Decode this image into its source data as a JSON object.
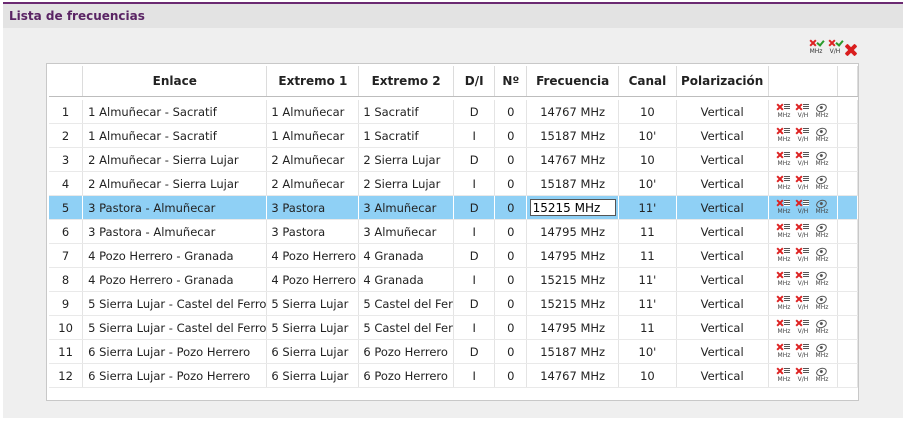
{
  "window": {
    "title": "Lista de frecuencias"
  },
  "toolbar": {
    "mhz_label": "MHz",
    "vh_label": "V/H"
  },
  "table": {
    "columns": [
      "Enlace",
      "Extremo 1",
      "Extremo 2",
      "D/I",
      "Nº",
      "Frecuencia",
      "Canal",
      "Polarización"
    ],
    "row_action_labels": [
      "MHz",
      "V/H",
      "MHz"
    ],
    "rows": [
      {
        "num": "1",
        "enlace": "1 Almuñecar - Sacratif",
        "ext1": "1 Almuñecar",
        "ext2": "1 Sacratif",
        "di": "D",
        "n": "0",
        "freq": "14767 MHz",
        "canal": "10",
        "pol": "Vertical"
      },
      {
        "num": "2",
        "enlace": "1 Almuñecar - Sacratif",
        "ext1": "1 Almuñecar",
        "ext2": "1 Sacratif",
        "di": "I",
        "n": "0",
        "freq": "15187 MHz",
        "canal": "10'",
        "pol": "Vertical"
      },
      {
        "num": "3",
        "enlace": "2 Almuñecar - Sierra Lujar",
        "ext1": "2 Almuñecar",
        "ext2": "2 Sierra Lujar",
        "di": "D",
        "n": "0",
        "freq": "14767 MHz",
        "canal": "10",
        "pol": "Vertical"
      },
      {
        "num": "4",
        "enlace": "2 Almuñecar - Sierra Lujar",
        "ext1": "2 Almuñecar",
        "ext2": "2 Sierra Lujar",
        "di": "I",
        "n": "0",
        "freq": "15187 MHz",
        "canal": "10'",
        "pol": "Vertical"
      },
      {
        "num": "5",
        "enlace": "3 Pastora - Almuñecar",
        "ext1": "3 Pastora",
        "ext2": "3 Almuñecar",
        "di": "D",
        "n": "0",
        "freq": "15215 MHz",
        "canal": "11'",
        "pol": "Vertical",
        "selected": true
      },
      {
        "num": "6",
        "enlace": "3 Pastora - Almuñecar",
        "ext1": "3 Pastora",
        "ext2": "3 Almuñecar",
        "di": "I",
        "n": "0",
        "freq": "14795 MHz",
        "canal": "11",
        "pol": "Vertical"
      },
      {
        "num": "7",
        "enlace": "4 Pozo Herrero - Granada",
        "ext1": "4 Pozo Herrero",
        "ext2": "4 Granada",
        "di": "D",
        "n": "0",
        "freq": "14795 MHz",
        "canal": "11",
        "pol": "Vertical"
      },
      {
        "num": "8",
        "enlace": "4 Pozo Herrero - Granada",
        "ext1": "4 Pozo Herrero",
        "ext2": "4 Granada",
        "di": "I",
        "n": "0",
        "freq": "15215 MHz",
        "canal": "11'",
        "pol": "Vertical"
      },
      {
        "num": "9",
        "enlace": "5 Sierra Lujar - Castel del Ferro",
        "ext1": "5 Sierra Lujar",
        "ext2": "5 Castel del Fer",
        "di": "D",
        "n": "0",
        "freq": "15215 MHz",
        "canal": "11'",
        "pol": "Vertical"
      },
      {
        "num": "10",
        "enlace": "5 Sierra Lujar - Castel del Ferro",
        "ext1": "5 Sierra Lujar",
        "ext2": "5 Castel del Fer",
        "di": "I",
        "n": "0",
        "freq": "14795 MHz",
        "canal": "11",
        "pol": "Vertical"
      },
      {
        "num": "11",
        "enlace": "6 Sierra Lujar - Pozo Herrero",
        "ext1": "6 Sierra Lujar",
        "ext2": "6 Pozo Herrero",
        "di": "D",
        "n": "0",
        "freq": "15187 MHz",
        "canal": "10'",
        "pol": "Vertical"
      },
      {
        "num": "12",
        "enlace": "6 Sierra Lujar - Pozo Herrero",
        "ext1": "6 Sierra Lujar",
        "ext2": "6 Pozo Herrero",
        "di": "I",
        "n": "0",
        "freq": "14767 MHz",
        "canal": "10",
        "pol": "Vertical"
      }
    ]
  },
  "colors": {
    "title": "#5a2464",
    "selected_row": "#8fd0f5",
    "delete_icon": "#d91e1e"
  },
  "icons": {
    "toolbar": [
      "delete-mhz-icon",
      "check-vh-icon",
      "delete-all-icon"
    ],
    "row": [
      "delete-mhz-icon",
      "delete-vh-icon",
      "view-mhz-icon"
    ]
  }
}
